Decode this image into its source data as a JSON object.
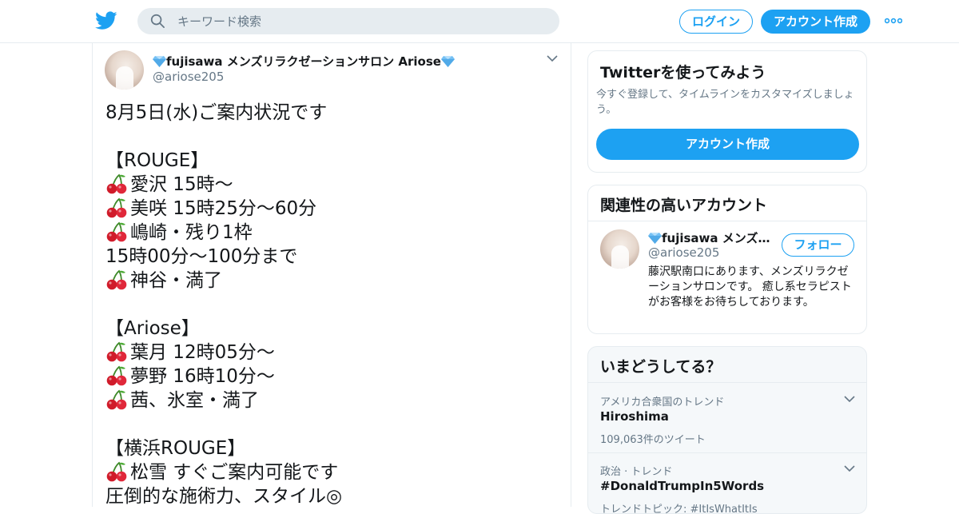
{
  "header": {
    "search_placeholder": "キーワード検索",
    "login_label": "ログイン",
    "signup_label": "アカウント作成"
  },
  "tweet": {
    "display_name": "fujisawa メンズリラクゼーションサロン Ariose",
    "handle": "@ariose205",
    "lines": [
      {
        "cherry": false,
        "text": "8月5日(水)ご案内状況です"
      },
      {
        "cherry": false,
        "text": ""
      },
      {
        "cherry": false,
        "text": "【ROUGE】"
      },
      {
        "cherry": true,
        "text": "愛沢 15時～"
      },
      {
        "cherry": true,
        "text": "美咲 15時25分～60分"
      },
      {
        "cherry": true,
        "text": "嶋崎・残り1枠"
      },
      {
        "cherry": false,
        "text": "15時00分～100分まで"
      },
      {
        "cherry": true,
        "text": "神谷・満了"
      },
      {
        "cherry": false,
        "text": ""
      },
      {
        "cherry": false,
        "text": "【Ariose】"
      },
      {
        "cherry": true,
        "text": "葉月 12時05分～"
      },
      {
        "cherry": true,
        "text": "夢野 16時10分～"
      },
      {
        "cherry": true,
        "text": "茜、氷室・満了"
      },
      {
        "cherry": false,
        "text": ""
      },
      {
        "cherry": false,
        "text": "【横浜ROUGE】"
      },
      {
        "cherry": true,
        "text": "松雪 すぐご案内可能です"
      },
      {
        "cherry": false,
        "text": "圧倒的な施術力、スタイル◎"
      }
    ]
  },
  "signup_card": {
    "title": "Twitterを使ってみよう",
    "subtitle": "今すぐ登録して、タイムラインをカスタマイズしましょう。",
    "button_label": "アカウント作成"
  },
  "related_card": {
    "title": "関連性の高いアカウント",
    "account": {
      "display_name": "fujisawa メンズリ…",
      "handle": "@ariose205",
      "follow_label": "フォロー",
      "bio": "藤沢駅南口にあります、メンズリラクゼーションサロンです。 癒し系セラピストがお客様をお待ちしております。"
    }
  },
  "trends_card": {
    "title": "いまどうしてる？",
    "items": [
      {
        "category": "アメリカ合衆国のトレンド",
        "name": "Hiroshima",
        "count": "109,063件のツイート"
      },
      {
        "category": "政治 · トレンド",
        "name": "#DonaldTrumpIn5Words",
        "count": "トレンドトピック: #ItIsWhatItIs"
      }
    ]
  },
  "colors": {
    "accent": "#1da1f2",
    "text": "#14171a",
    "muted": "#657786",
    "border": "#e6ecf0"
  }
}
